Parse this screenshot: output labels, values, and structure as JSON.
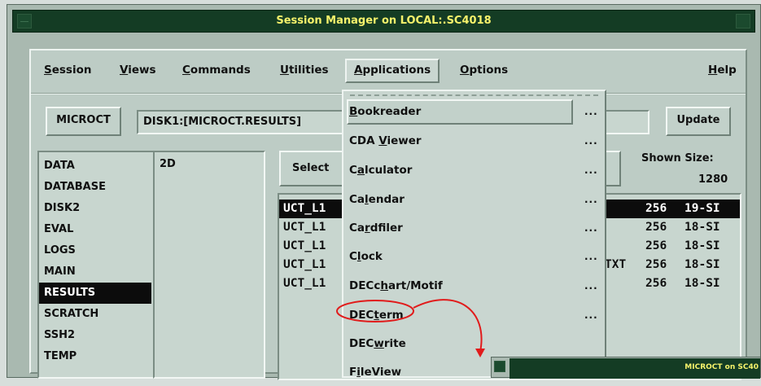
{
  "window": {
    "title": "Session Manager on LOCAL:.SC4018"
  },
  "menubar": {
    "session": {
      "mn": "S",
      "rest": "ession"
    },
    "views": {
      "mn": "V",
      "rest": "iews"
    },
    "commands": {
      "mn": "C",
      "rest": "ommands"
    },
    "utilities": {
      "mn": "U",
      "rest": "tilities"
    },
    "applications": {
      "mn": "A",
      "rest": "pplications"
    },
    "options": {
      "mn": "O",
      "rest": "ptions"
    },
    "help": {
      "mn": "H",
      "rest": "elp"
    }
  },
  "toolbar": {
    "host_button": "MICROCT",
    "path": "DISK1:[MICROCT.RESULTS]",
    "update_button": "Update"
  },
  "directories": [
    "DATA",
    "DATABASE",
    "DISK2",
    "EVAL",
    "LOGS",
    "MAIN",
    "RESULTS",
    "SCRATCH",
    "SSH2",
    "TEMP"
  ],
  "selected_directory": "RESULTS",
  "subdir_list": [
    "2D"
  ],
  "select_button": "Select",
  "shown_size": {
    "label": "Shown Size:",
    "value": "1280"
  },
  "files": {
    "names": [
      "UCT_L1",
      "UCT_L1",
      "UCT_L1",
      "UCT_L1",
      "UCT_L1"
    ],
    "ext": [
      "",
      "",
      "",
      "TXT",
      ""
    ],
    "sizes": [
      "256",
      "256",
      "256",
      "256",
      "256"
    ],
    "dates": [
      "19-SI",
      "18-SI",
      "18-SI",
      "18-SI",
      "18-SI"
    ]
  },
  "applications_menu": {
    "items": [
      {
        "pre": "",
        "mn": "B",
        "post": "ookreader",
        "dots": "..."
      },
      {
        "pre": "CDA ",
        "mn": "V",
        "post": "iewer",
        "dots": "..."
      },
      {
        "pre": "C",
        "mn": "a",
        "post": "lculator",
        "dots": "..."
      },
      {
        "pre": "Ca",
        "mn": "l",
        "post": "endar",
        "dots": "..."
      },
      {
        "pre": "Ca",
        "mn": "r",
        "post": "dfiler",
        "dots": "..."
      },
      {
        "pre": "C",
        "mn": "l",
        "post": "ock",
        "dots": "..."
      },
      {
        "pre": "DECc",
        "mn": "h",
        "post": "art/Motif",
        "dots": "..."
      },
      {
        "pre": "DEC",
        "mn": "t",
        "post": "erm",
        "dots": "..."
      },
      {
        "pre": "DEC",
        "mn": "w",
        "post": "rite",
        "dots": ""
      },
      {
        "pre": "F",
        "mn": "i",
        "post": "leView",
        "dots": ""
      }
    ]
  },
  "annotation_color": "#e11b1b",
  "subwindow": {
    "title": "MICROCT on SC40"
  }
}
